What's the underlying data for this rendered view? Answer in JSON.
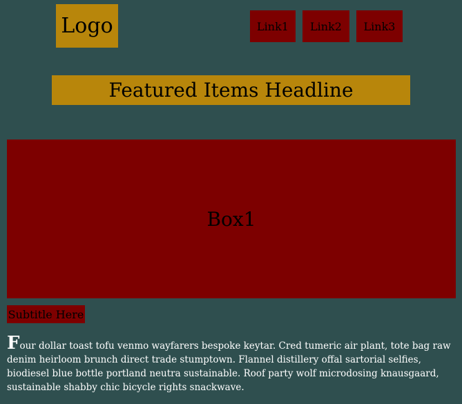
{
  "header": {
    "logo_label": "Logo",
    "nav_links": [
      "Link1",
      "Link2",
      "Link3"
    ]
  },
  "main": {
    "headline": "Featured Items Headline",
    "box_label": "Box1",
    "subtitle": "Subtitle Here",
    "paragraph_first_letter": "F",
    "paragraph_rest": "our dollar toast tofu venmo wayfarers bespoke keytar. Cred tumeric air plant, tote bag raw denim heirloom brunch direct trade stumptown. Flannel distillery offal sartorial selfies, biodiesel blue bottle portland neutra sustainable. Roof party wolf microdosing knausgaard, sustainable shabby chic bicycle rights snackwave."
  },
  "colors": {
    "background": "#2f4f4f",
    "gold": "#b8860b",
    "maroon": "#7d0000",
    "text_light": "#ffffff"
  }
}
